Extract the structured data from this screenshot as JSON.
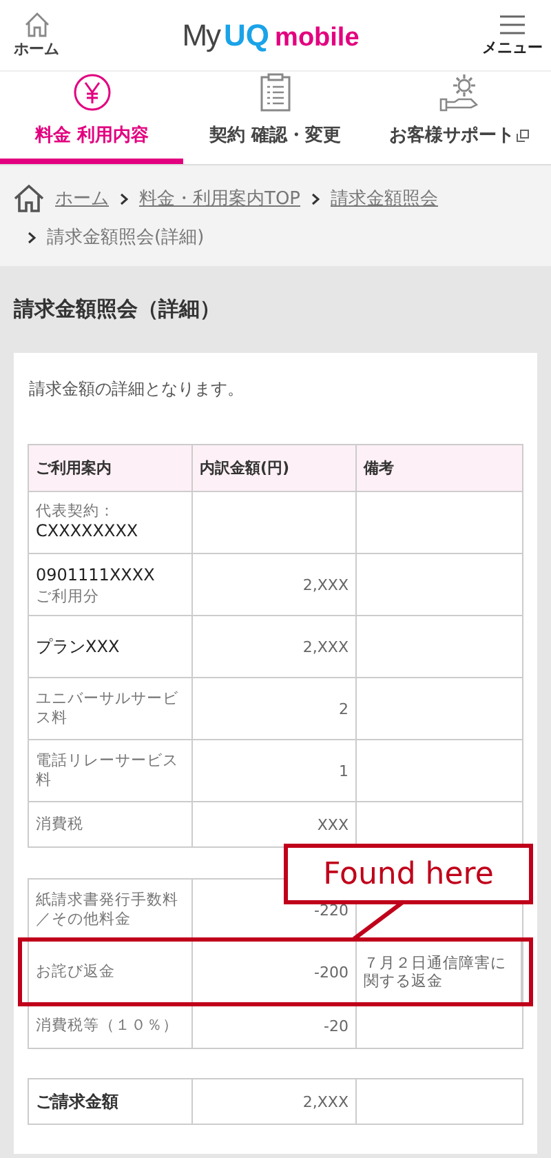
{
  "header": {
    "home_label": "ホーム",
    "logo": {
      "my": "My",
      "uq": "UQ",
      "mobile": "mobile"
    },
    "menu_label": "メニュー"
  },
  "tabs": [
    {
      "label": "料金 利用内容",
      "selected": true,
      "external": false
    },
    {
      "label": "契約 確認・変更",
      "selected": false,
      "external": false
    },
    {
      "label": "お客様サポート",
      "selected": false,
      "external": true
    }
  ],
  "breadcrumb": {
    "links": [
      "ホーム",
      "料金・利用案内TOP",
      "請求金額照会"
    ],
    "current": "請求金額照会(詳細)"
  },
  "page_title": "請求金額照会（詳細）",
  "description": "請求金額の詳細となります。",
  "table": {
    "columns": [
      "ご利用案内",
      "内訳金額(円)",
      "備考"
    ],
    "groups": [
      {
        "rows": [
          {
            "kind": "item",
            "highlighted": false,
            "lines": [
              {
                "text": "代表契約：",
                "kind": "sub"
              },
              {
                "text": "CXXXXXXXX",
                "kind": "main"
              }
            ]
          },
          {
            "kind": "item",
            "highlighted": false,
            "lines": [
              {
                "text": "0901111XXXX",
                "kind": "main"
              },
              {
                "text": "ご利用分",
                "kind": "sub"
              }
            ],
            "amount": "2,XXX"
          },
          {
            "kind": "item",
            "highlighted": false,
            "lines": [
              {
                "text": "プランXXX",
                "kind": "main"
              }
            ],
            "amount": "2,XXX"
          },
          {
            "kind": "item",
            "highlighted": false,
            "lines": [
              {
                "text": "ユニバーサルサービス料",
                "kind": "sub"
              }
            ],
            "amount": "2"
          },
          {
            "kind": "item",
            "highlighted": false,
            "lines": [
              {
                "text": "電話リレーサービス料",
                "kind": "sub"
              }
            ],
            "amount": "1"
          },
          {
            "kind": "item",
            "highlighted": false,
            "lines": [
              {
                "text": "消費税",
                "kind": "sub"
              }
            ],
            "amount": "XXX"
          }
        ]
      },
      {
        "rows": [
          {
            "kind": "item",
            "highlighted": false,
            "lines": [
              {
                "text": "紙請求書発行手数料／その他料金",
                "kind": "sub"
              }
            ],
            "amount": "-220"
          },
          {
            "kind": "item",
            "highlighted": true,
            "lines": [
              {
                "text": "お詫び返金",
                "kind": "sub"
              }
            ],
            "amount": "-200",
            "remarks": "７月２日通信障害に関する返金"
          },
          {
            "kind": "item",
            "highlighted": false,
            "lines": [
              {
                "text": "消費税等（１０％）",
                "kind": "sub"
              }
            ],
            "amount": "-20"
          }
        ]
      },
      {
        "rows": [
          {
            "kind": "total",
            "highlighted": false,
            "lines": [
              {
                "text": "ご請求金額",
                "kind": "main"
              }
            ],
            "amount": "2,XXX"
          }
        ]
      }
    ]
  },
  "annotation": {
    "text": "Found here"
  }
}
